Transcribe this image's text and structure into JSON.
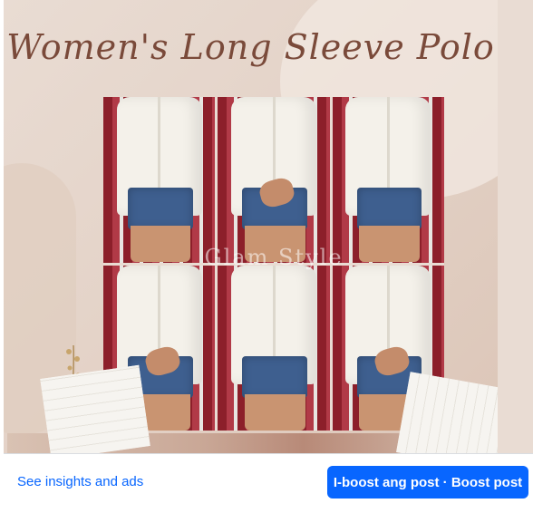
{
  "post": {
    "title": "Women's Long Sleeve Polo",
    "watermark": "Glam Style",
    "photo_count": 6
  },
  "actions": {
    "insights_label": "See insights and ads",
    "boost_label": "I-boost ang post · Boost post"
  },
  "colors": {
    "accent": "#0866ff",
    "title_color": "#7a4a3a",
    "background": "#e9dcd3"
  }
}
